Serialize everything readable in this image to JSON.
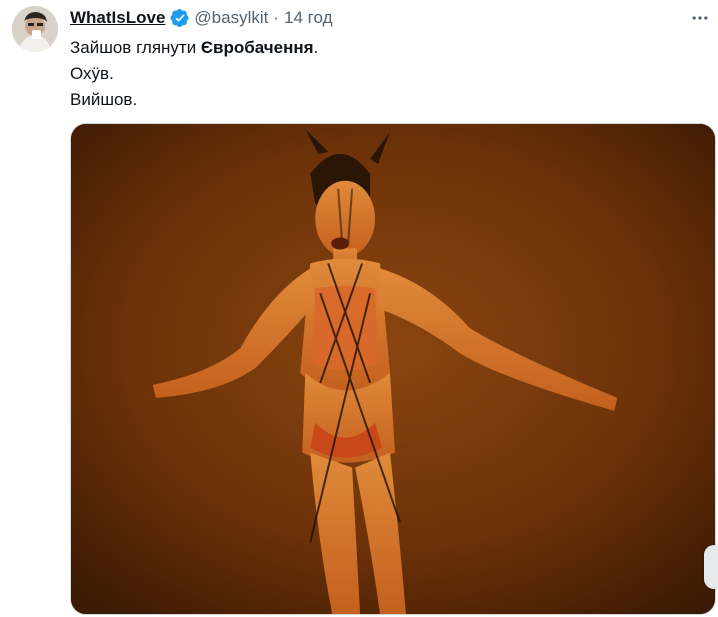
{
  "tweet": {
    "author_name": "WhatIsLove",
    "handle": "@basylkit",
    "separator": "·",
    "time": "14 год",
    "line1_prefix": "Зайшов глянути ",
    "line1_bold": "Євробачення",
    "line1_suffix": ".",
    "line2": "Охӱв.",
    "line3": "Вийшов."
  },
  "icons": {
    "verified": "verified-badge-icon",
    "more": "more-icon"
  },
  "colors": {
    "verified_blue": "#1d9bf0",
    "secondary_text": "#536471",
    "media_background": "#6b3108"
  }
}
